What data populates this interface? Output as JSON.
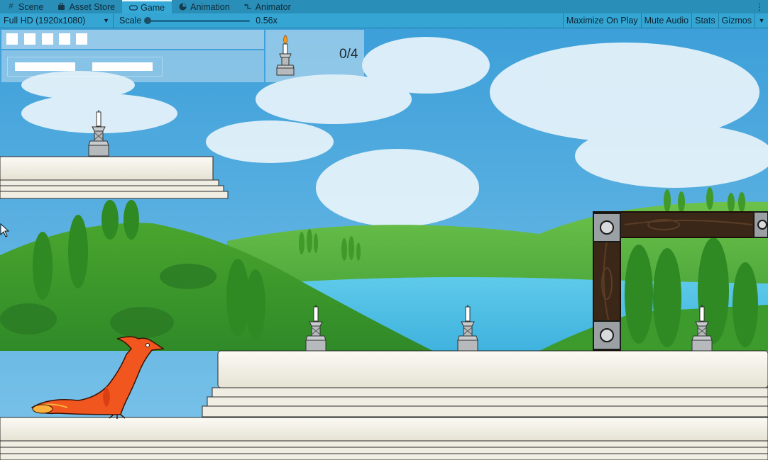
{
  "tabs": [
    {
      "label": "Scene",
      "icon": "grid-icon"
    },
    {
      "label": "Asset Store",
      "icon": "bag-icon"
    },
    {
      "label": "Game",
      "icon": "gamepad-icon",
      "active": true
    },
    {
      "label": "Animation",
      "icon": "clock-icon"
    },
    {
      "label": "Animator",
      "icon": "animator-icon"
    }
  ],
  "toolbar": {
    "resolution": "Full HD (1920x1080)",
    "scale_label": "Scale",
    "scale_value": "0.56x",
    "maximize_label": "Maximize On Play",
    "mute_label": "Mute Audio",
    "stats_label": "Stats",
    "gizmos_label": "Gizmos"
  },
  "hud": {
    "lives": 5,
    "candle_counter": "0/4"
  },
  "colors": {
    "tab_bar": "#2a8fb8",
    "toolbar": "#35a6d3",
    "sky": "#4aa7dc",
    "hill": "#3f9a2a",
    "lake": "#4cc3e6",
    "platform": "#f3f0e6",
    "wood": "#3b2718",
    "phoenix": "#f0561e"
  }
}
